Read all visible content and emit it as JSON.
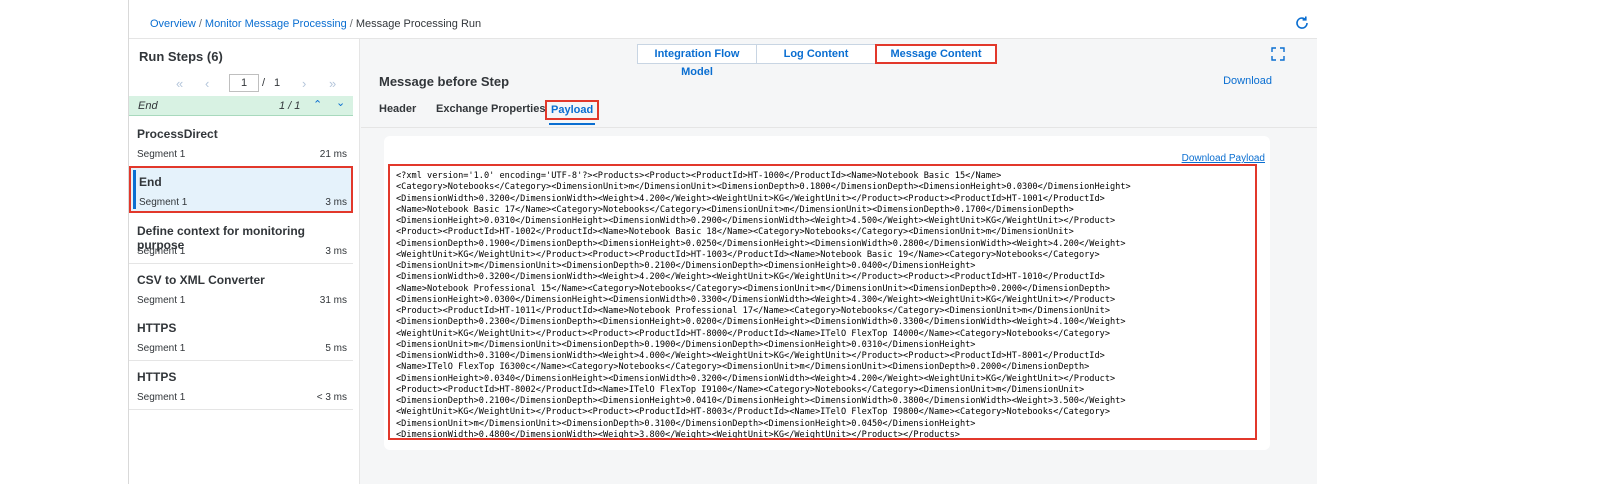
{
  "breadcrumb": {
    "items": [
      "Overview",
      "Monitor Message Processing"
    ],
    "separator": "/",
    "current": "Message Processing Run"
  },
  "left_panel": {
    "title": "Run Steps (6)",
    "pager": {
      "first": "«",
      "prev": "‹",
      "page_value": "1",
      "of_sep": "/",
      "total": "1",
      "next": "›",
      "last": "»"
    },
    "filter_bar": {
      "label": "End",
      "count": "1 / 1",
      "up": "⌃",
      "down": "⌄"
    },
    "steps": [
      {
        "title": "ProcessDirect",
        "segment": "Segment 1",
        "duration": "21 ms"
      },
      {
        "title": "End",
        "segment": "Segment 1",
        "duration": "3 ms"
      },
      {
        "title": "Define context for monitoring purpose",
        "segment": "Segment 1",
        "duration": "3 ms"
      },
      {
        "title": "CSV to XML Converter",
        "segment": "Segment 1",
        "duration": "31 ms"
      },
      {
        "title": "HTTPS",
        "segment": "Segment 1",
        "duration": "5 ms"
      },
      {
        "title": "HTTPS",
        "segment": "Segment 1",
        "duration": "< 3 ms"
      }
    ]
  },
  "view_switch": {
    "model": "Integration Flow Model",
    "log": "Log Content",
    "message": "Message Content"
  },
  "content": {
    "title": "Message before Step",
    "download": "Download",
    "tabs": [
      "Header",
      "Exchange Properties",
      "Payload"
    ],
    "download_payload": "Download Payload",
    "payload_lines": [
      "<?xml version='1.0' encoding='UTF-8'?><Products><Product><ProductId>HT-1000</ProductId><Name>Notebook Basic 15</Name>",
      "<Category>Notebooks</Category><DimensionUnit>m</DimensionUnit><DimensionDepth>0.1800</DimensionDepth><DimensionHeight>0.0300</DimensionHeight>",
      "<DimensionWidth>0.3200</DimensionWidth><Weight>4.200</Weight><WeightUnit>KG</WeightUnit></Product><Product><ProductId>HT-1001</ProductId>",
      "<Name>Notebook Basic 17</Name><Category>Notebooks</Category><DimensionUnit>m</DimensionUnit><DimensionDepth>0.1700</DimensionDepth>",
      "<DimensionHeight>0.0310</DimensionHeight><DimensionWidth>0.2900</DimensionWidth><Weight>4.500</Weight><WeightUnit>KG</WeightUnit></Product>",
      "<Product><ProductId>HT-1002</ProductId><Name>Notebook Basic 18</Name><Category>Notebooks</Category><DimensionUnit>m</DimensionUnit>",
      "<DimensionDepth>0.1900</DimensionDepth><DimensionHeight>0.0250</DimensionHeight><DimensionWidth>0.2800</DimensionWidth><Weight>4.200</Weight>",
      "<WeightUnit>KG</WeightUnit></Product><Product><ProductId>HT-1003</ProductId><Name>Notebook Basic 19</Name><Category>Notebooks</Category>",
      "<DimensionUnit>m</DimensionUnit><DimensionDepth>0.2100</DimensionDepth><DimensionHeight>0.0400</DimensionHeight>",
      "<DimensionWidth>0.3200</DimensionWidth><Weight>4.200</Weight><WeightUnit>KG</WeightUnit></Product><Product><ProductId>HT-1010</ProductId>",
      "<Name>Notebook Professional 15</Name><Category>Notebooks</Category><DimensionUnit>m</DimensionUnit><DimensionDepth>0.2000</DimensionDepth>",
      "<DimensionHeight>0.0300</DimensionHeight><DimensionWidth>0.3300</DimensionWidth><Weight>4.300</Weight><WeightUnit>KG</WeightUnit></Product>",
      "<Product><ProductId>HT-1011</ProductId><Name>Notebook Professional 17</Name><Category>Notebooks</Category><DimensionUnit>m</DimensionUnit>",
      "<DimensionDepth>0.2300</DimensionDepth><DimensionHeight>0.0200</DimensionHeight><DimensionWidth>0.3300</DimensionWidth><Weight>4.100</Weight>",
      "<WeightUnit>KG</WeightUnit></Product><Product><ProductId>HT-8000</ProductId><Name>ITelO FlexTop I4000</Name><Category>Notebooks</Category>",
      "<DimensionUnit>m</DimensionUnit><DimensionDepth>0.1900</DimensionDepth><DimensionHeight>0.0310</DimensionHeight>",
      "<DimensionWidth>0.3100</DimensionWidth><Weight>4.000</Weight><WeightUnit>KG</WeightUnit></Product><Product><ProductId>HT-8001</ProductId>",
      "<Name>ITelO FlexTop I6300c</Name><Category>Notebooks</Category><DimensionUnit>m</DimensionUnit><DimensionDepth>0.2000</DimensionDepth>",
      "<DimensionHeight>0.0340</DimensionHeight><DimensionWidth>0.3200</DimensionWidth><Weight>4.200</Weight><WeightUnit>KG</WeightUnit></Product>",
      "<Product><ProductId>HT-8002</ProductId><Name>ITelO FlexTop I9100</Name><Category>Notebooks</Category><DimensionUnit>m</DimensionUnit>",
      "<DimensionDepth>0.2100</DimensionDepth><DimensionHeight>0.0410</DimensionHeight><DimensionWidth>0.3800</DimensionWidth><Weight>3.500</Weight>",
      "<WeightUnit>KG</WeightUnit></Product><Product><ProductId>HT-8003</ProductId><Name>ITelO FlexTop I9800</Name><Category>Notebooks</Category>",
      "<DimensionUnit>m</DimensionUnit><DimensionDepth>0.3100</DimensionDepth><DimensionHeight>0.0450</DimensionHeight>",
      "<DimensionWidth>0.4800</DimensionWidth><Weight>3.800</Weight><WeightUnit>KG</WeightUnit></Product></Products>"
    ]
  },
  "colors": {
    "accent": "#0a6ed1",
    "highlight_border": "#e2382b",
    "selected_step_bg": "#e5f2fb",
    "filter_bar_bg": "#d8f2e3"
  },
  "icons": {
    "refresh": "refresh-icon",
    "expand": "fullscreen-icon"
  }
}
